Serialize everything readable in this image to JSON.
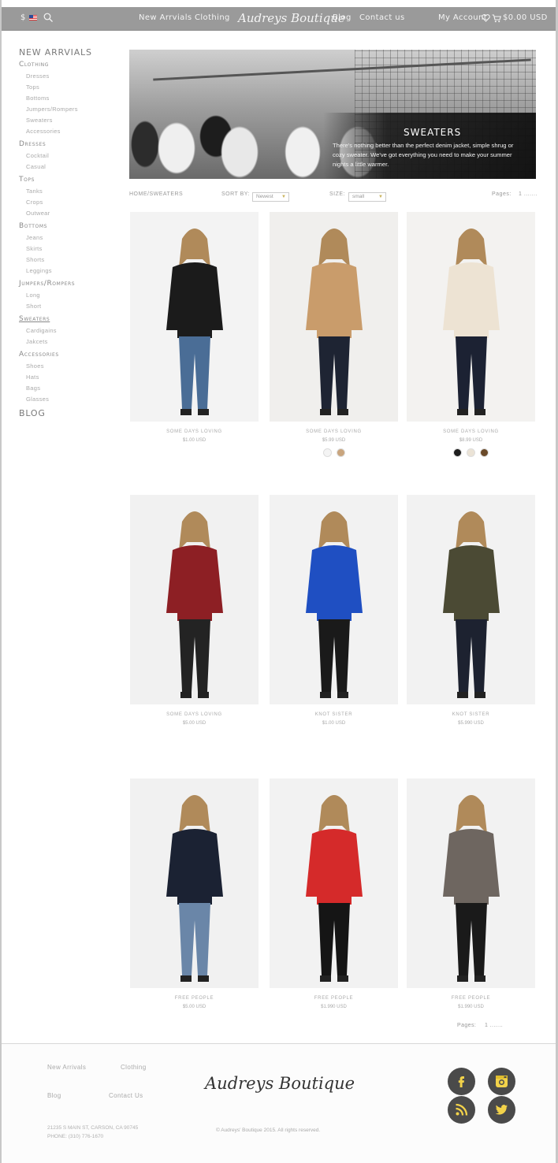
{
  "nav": {
    "currency": "$",
    "links": [
      "New Arrvials",
      "Clothing",
      "Blog",
      "Contact us"
    ],
    "brand": "Audreys Boutique",
    "account": "My Account",
    "cart_total": "$0.00 USD"
  },
  "sidebar": {
    "new_arrivals": "NEW ARRVIALS",
    "categories": [
      {
        "label": "Clothing",
        "items": [
          "Dresses",
          "Tops",
          "Bottoms",
          "Jumpers/Rompers",
          "Sweaters",
          "Accessories"
        ]
      },
      {
        "label": "Dresses",
        "items": [
          "Cocktail",
          "Casual"
        ]
      },
      {
        "label": "Tops",
        "items": [
          "Tanks",
          "Crops",
          "Outwear"
        ]
      },
      {
        "label": "Bottoms",
        "items": [
          "Jeans",
          "Skirts",
          "Shorts",
          "Leggings"
        ]
      },
      {
        "label": "Jumpers/Rompers",
        "items": [
          "Long",
          "Short"
        ]
      },
      {
        "label": "Sweaters",
        "items": [
          "Cardigains",
          "Jakcets"
        ]
      },
      {
        "label": "Accessories",
        "items": [
          "Shoes",
          "Hats",
          "Bags",
          "Glasses"
        ]
      }
    ],
    "blog": "BLOG"
  },
  "hero": {
    "title": "SWEATERS",
    "description": "There's nothing better than the perfect denim jacket, simple shrug or cozy sweater. We've got everything you need to make your summer nights a little warmer."
  },
  "toolbar": {
    "breadcrumb": "HOME/SWEATERS",
    "sort_label": "SORT BY:",
    "sort_value": "Newest",
    "size_label": "SIZE:",
    "size_value": "small",
    "pages_label": "Pages:",
    "page_value": "1 ......."
  },
  "products": [
    {
      "name": "SOME DAYS LOVING",
      "price": "$1.00 USD",
      "swatches": []
    },
    {
      "name": "SOME DAYS LOVING",
      "price": "$5.99 USD",
      "swatches": [
        "#f4f4f4",
        "#c9a57e"
      ]
    },
    {
      "name": "SOME DAYS LOVING",
      "price": "$8.99 USD",
      "swatches": [
        "#1e1e1e",
        "#ebe3d6",
        "#6a4a2a"
      ]
    },
    {
      "name": "SOME DAYS LOVING",
      "price": "$5.00 USD",
      "swatches": []
    },
    {
      "name": "KNOT SISTER",
      "price": "$1.00 USD",
      "swatches": []
    },
    {
      "name": "KNOT SISTER",
      "price": "$5.990 USD",
      "swatches": []
    },
    {
      "name": "FREE PEOPLE",
      "price": "$5.00 USD",
      "swatches": []
    },
    {
      "name": "FREE PEOPLE",
      "price": "$1.990 USD",
      "swatches": []
    },
    {
      "name": "FREE PEOPLE",
      "price": "$1.990 USD",
      "swatches": []
    }
  ],
  "bottom_pager": {
    "label": "Pages:",
    "value": "1 ......."
  },
  "footer": {
    "links": [
      "New Arrivals",
      "Clothing",
      "Blog",
      "Contact Us"
    ],
    "brand": "Audreys Boutique",
    "address": "21235 S MAIN ST, CARSON, CA 90745",
    "phone": "PHONE: (310) 776-1670",
    "copyright": "© Audreys' Boutique 2015. All rights reserved.",
    "social": [
      "facebook-icon",
      "instagram-icon",
      "rss-icon",
      "twitter-icon"
    ]
  },
  "colors": {
    "accent": "#c9b35c",
    "nav_bg": "#9a9a9a",
    "social_bg": "#4a4a4a",
    "social_fg": "#f2d24a"
  }
}
